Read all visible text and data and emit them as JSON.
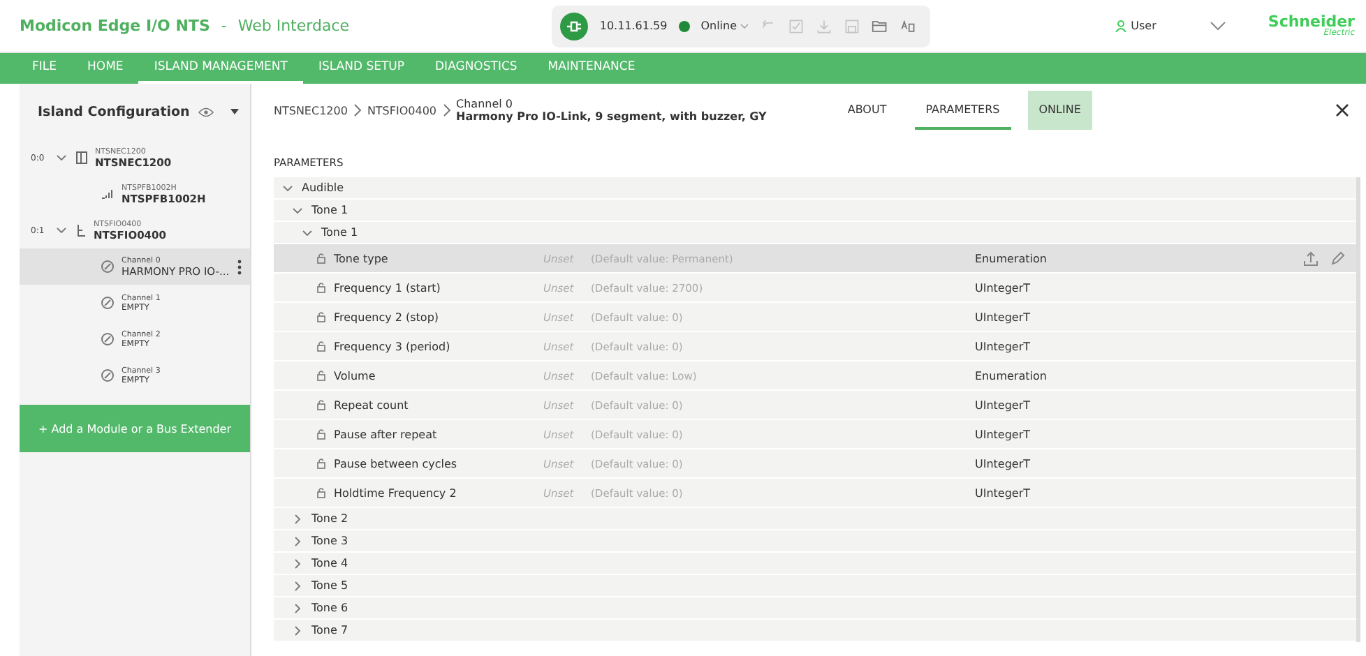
{
  "header": {
    "app_name": "Modicon Edge I/O NTS",
    "separator": "-",
    "subtitle": "Web Interdace"
  },
  "connection": {
    "address": "10.11.61.59",
    "status": "Online",
    "online": true
  },
  "toolbar": [
    {
      "kind": "undo",
      "disabled": true
    },
    {
      "kind": "check",
      "disabled": true
    },
    {
      "kind": "download",
      "disabled": true
    },
    {
      "kind": "save",
      "disabled": true
    },
    {
      "kind": "folder",
      "disabled": false
    },
    {
      "kind": "language",
      "disabled": false
    }
  ],
  "user": {
    "name": "User"
  },
  "logo": {
    "brand": "Schneider",
    "sub": "Electric"
  },
  "menu": [
    {
      "label": "FILE",
      "selected": false
    },
    {
      "label": "HOME",
      "selected": false
    },
    {
      "label": "ISLAND MANAGEMENT",
      "selected": true
    },
    {
      "label": "ISLAND SETUP",
      "selected": false
    },
    {
      "label": "DIAGNOSTICS",
      "selected": false
    },
    {
      "label": "MAINTENANCE",
      "selected": false
    }
  ],
  "sidebar": {
    "title": "Island Configuration",
    "tree": [
      {
        "slot": "0:0",
        "code": "NTSNEC1200",
        "name": "NTSNEC1200",
        "kind": "coupler",
        "expanded": true,
        "selected": false,
        "children": [
          {
            "code": "NTSPFB1002H",
            "name": "NTSPFB1002H",
            "kind": "power",
            "selected": false
          }
        ]
      },
      {
        "slot": "0:1",
        "code": "NTSFIO0400",
        "name": "NTSFIO0400",
        "kind": "io",
        "expanded": true,
        "selected": false,
        "children": [
          {
            "code": "Channel 0",
            "name": "HARMONY PRO IO-...",
            "kind": "channel",
            "selected": true
          },
          {
            "code": "Channel 1",
            "name": "EMPTY",
            "kind": "channel",
            "selected": false
          },
          {
            "code": "Channel 2",
            "name": "EMPTY",
            "kind": "channel",
            "selected": false
          },
          {
            "code": "Channel 3",
            "name": "EMPTY",
            "kind": "channel",
            "selected": false
          }
        ]
      }
    ],
    "add_button": "+ Add a Module or a Bus Extender"
  },
  "breadcrumb": [
    "NTSNEC1200",
    "NTSFIO0400"
  ],
  "channel": {
    "label": "Channel 0",
    "device": "Harmony Pro IO-Link, 9 segment, with buzzer, GY"
  },
  "tabs": [
    {
      "label": "ABOUT",
      "selected": false,
      "highlighted": false
    },
    {
      "label": "PARAMETERS",
      "selected": true,
      "highlighted": false
    },
    {
      "label": "ONLINE",
      "selected": false,
      "highlighted": true
    }
  ],
  "section_title": "PARAMETERS",
  "parameters": [
    {
      "kind": "group",
      "name": "Audible",
      "expanded": true,
      "children": [
        {
          "kind": "group",
          "name": "Tone 1",
          "expanded": true,
          "children": [
            {
              "kind": "group",
              "name": "Tone 1",
              "expanded": true,
              "children": [
                {
                  "kind": "param",
                  "name": "Tone type",
                  "status": "Unset",
                  "default": "(Default value: Permanent)",
                  "type": "Enumeration",
                  "selected": true
                },
                {
                  "kind": "param",
                  "name": "Frequency 1 (start)",
                  "status": "Unset",
                  "default": "(Default value: 2700)",
                  "type": "UIntegerT",
                  "selected": false
                },
                {
                  "kind": "param",
                  "name": "Frequency 2 (stop)",
                  "status": "Unset",
                  "default": "(Default value: 0)",
                  "type": "UIntegerT",
                  "selected": false
                },
                {
                  "kind": "param",
                  "name": "Frequency 3 (period)",
                  "status": "Unset",
                  "default": "(Default value: 0)",
                  "type": "UIntegerT",
                  "selected": false
                },
                {
                  "kind": "param",
                  "name": "Volume",
                  "status": "Unset",
                  "default": "(Default value: Low)",
                  "type": "Enumeration",
                  "selected": false
                },
                {
                  "kind": "param",
                  "name": "Repeat count",
                  "status": "Unset",
                  "default": "(Default value: 0)",
                  "type": "UIntegerT",
                  "selected": false
                },
                {
                  "kind": "param",
                  "name": "Pause after repeat",
                  "status": "Unset",
                  "default": "(Default value: 0)",
                  "type": "UIntegerT",
                  "selected": false
                },
                {
                  "kind": "param",
                  "name": "Pause between cycles",
                  "status": "Unset",
                  "default": "(Default value: 0)",
                  "type": "UIntegerT",
                  "selected": false
                },
                {
                  "kind": "param",
                  "name": "Holdtime Frequency 2",
                  "status": "Unset",
                  "default": "(Default value: 0)",
                  "type": "UIntegerT",
                  "selected": false
                }
              ]
            }
          ]
        },
        {
          "kind": "group",
          "name": "Tone 2",
          "expanded": false
        },
        {
          "kind": "group",
          "name": "Tone 3",
          "expanded": false
        },
        {
          "kind": "group",
          "name": "Tone 4",
          "expanded": false
        },
        {
          "kind": "group",
          "name": "Tone 5",
          "expanded": false
        },
        {
          "kind": "group",
          "name": "Tone 6",
          "expanded": false
        },
        {
          "kind": "group",
          "name": "Tone 7",
          "expanded": false
        }
      ]
    }
  ]
}
